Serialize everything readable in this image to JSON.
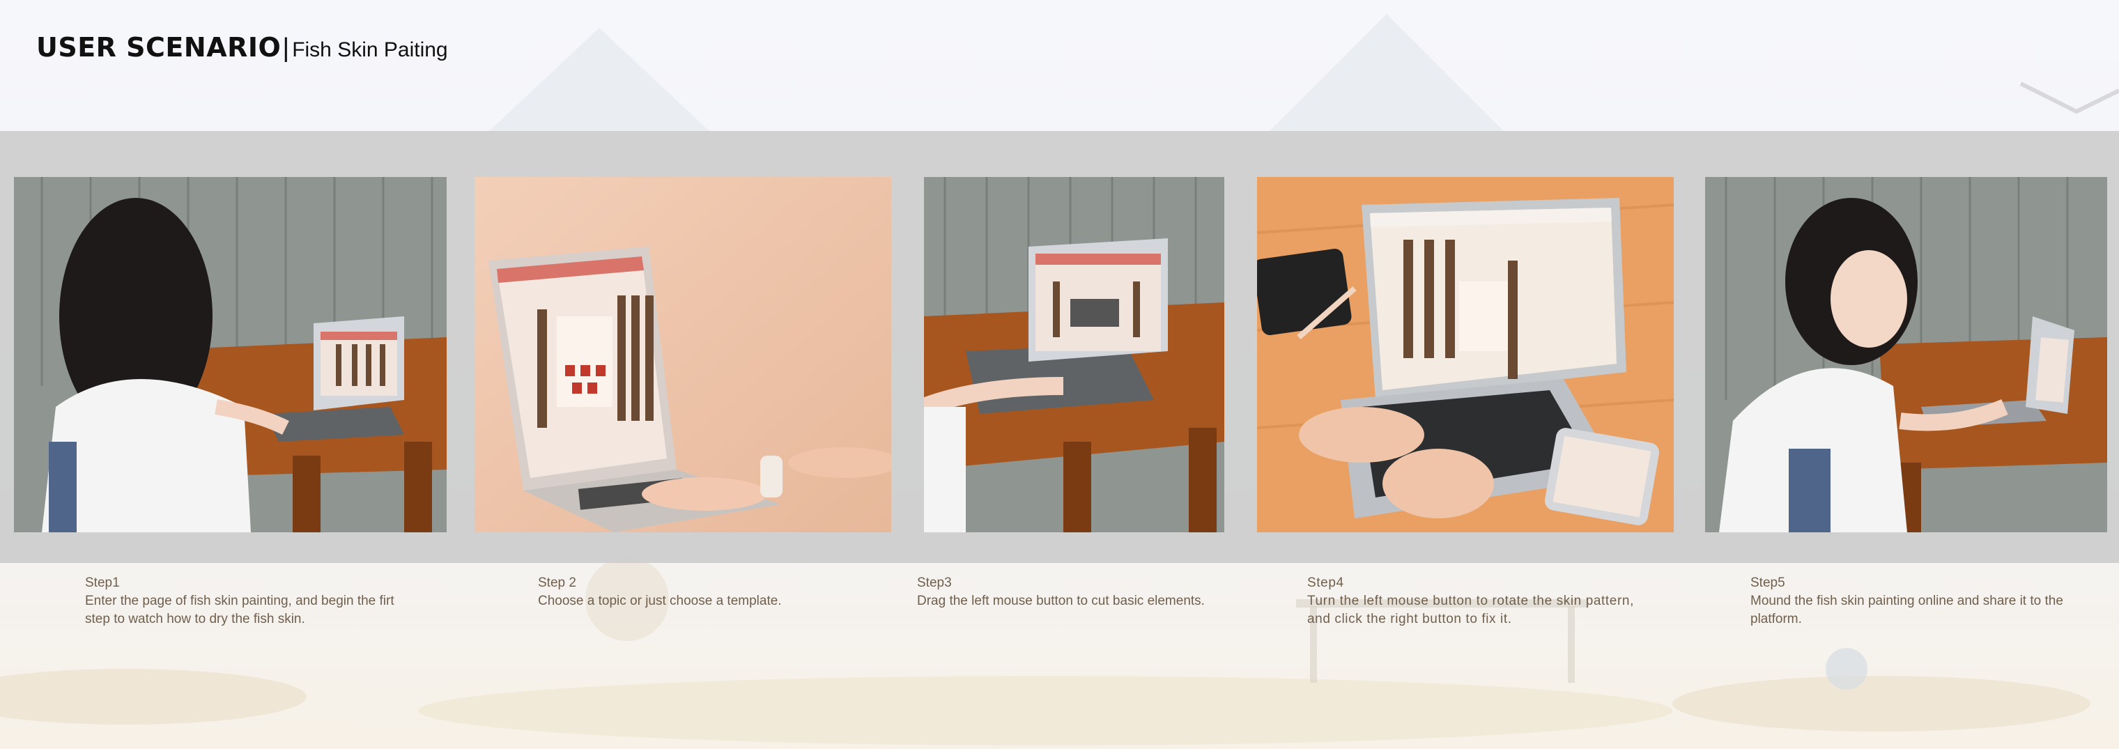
{
  "header": {
    "title": "USER SCENARIO",
    "separator": "|",
    "subtitle": "Fish Skin Paiting"
  },
  "colors": {
    "band": "#cdcdcd",
    "step_text": "#6f5f4c",
    "accent": "#d9746a"
  },
  "steps": [
    {
      "label": "Step1",
      "text": "Enter the page of fish skin painting, and begin the firt step to watch how to dry the fish skin."
    },
    {
      "label": "Step 2",
      "text": "Choose a topic or just choose a template."
    },
    {
      "label": "Step3",
      "text": "Drag the left mouse button to cut basic elements."
    },
    {
      "label": "Step4",
      "text": "Turn the left mouse button to rotate the skin pattern, and click the right button to fix it."
    },
    {
      "label": "Step5",
      "text": "Mound the fish skin painting online and share it to the platform."
    }
  ]
}
